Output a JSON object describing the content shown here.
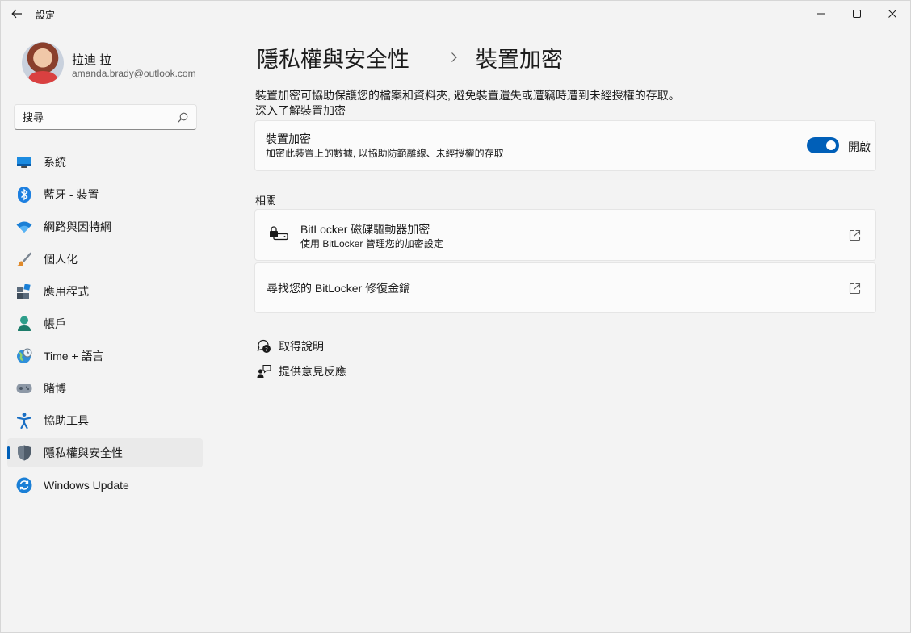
{
  "window": {
    "title": "設定"
  },
  "profile": {
    "name": "拉迪 拉",
    "email": "amanda.brady@outlook.com"
  },
  "search": {
    "placeholder": "搜尋"
  },
  "sidebar": {
    "items": [
      {
        "label": "系統",
        "icon": "system-icon"
      },
      {
        "label": "藍牙 - 裝置",
        "icon": "bluetooth-icon"
      },
      {
        "label": "網路與因特網",
        "icon": "wifi-icon"
      },
      {
        "label": "個人化",
        "icon": "brush-icon"
      },
      {
        "label": "應用程式",
        "icon": "apps-icon"
      },
      {
        "label": "帳戶",
        "icon": "account-icon"
      },
      {
        "label": "Time + 語言",
        "icon": "time-language-icon"
      },
      {
        "label": "賭博",
        "icon": "gaming-icon"
      },
      {
        "label": "協助工具",
        "icon": "accessibility-icon"
      },
      {
        "label": "隱私權與安全性",
        "icon": "shield-icon",
        "selected": true
      },
      {
        "label": "Windows Update",
        "icon": "windows-update-icon"
      }
    ]
  },
  "breadcrumb": {
    "parent": "隱私權與安全性",
    "current": "裝置加密"
  },
  "main": {
    "description": "裝置加密可協助保護您的檔案和資料夾, 避免裝置遺失或遭竊時遭到未經授權的存取。",
    "learn_more": "深入了解裝置加密",
    "encryption_card": {
      "title": "裝置加密",
      "subtitle": "加密此裝置上的數據, 以協助防範離線、未經授權的存取",
      "toggle_state": "開啟",
      "toggle_on": true
    },
    "related_heading": "相關",
    "bitlocker_card": {
      "title": "BitLocker 磁碟驅動器加密",
      "subtitle": "使用 BitLocker 管理您的加密設定"
    },
    "recovery_card": {
      "title": "尋找您的 BitLocker 修復金鑰"
    },
    "help": {
      "get_help": "取得說明",
      "feedback": "提供意見反應"
    }
  },
  "colors": {
    "accent": "#005fb8",
    "background": "#f3f3f3",
    "card": "#fbfbfb"
  }
}
